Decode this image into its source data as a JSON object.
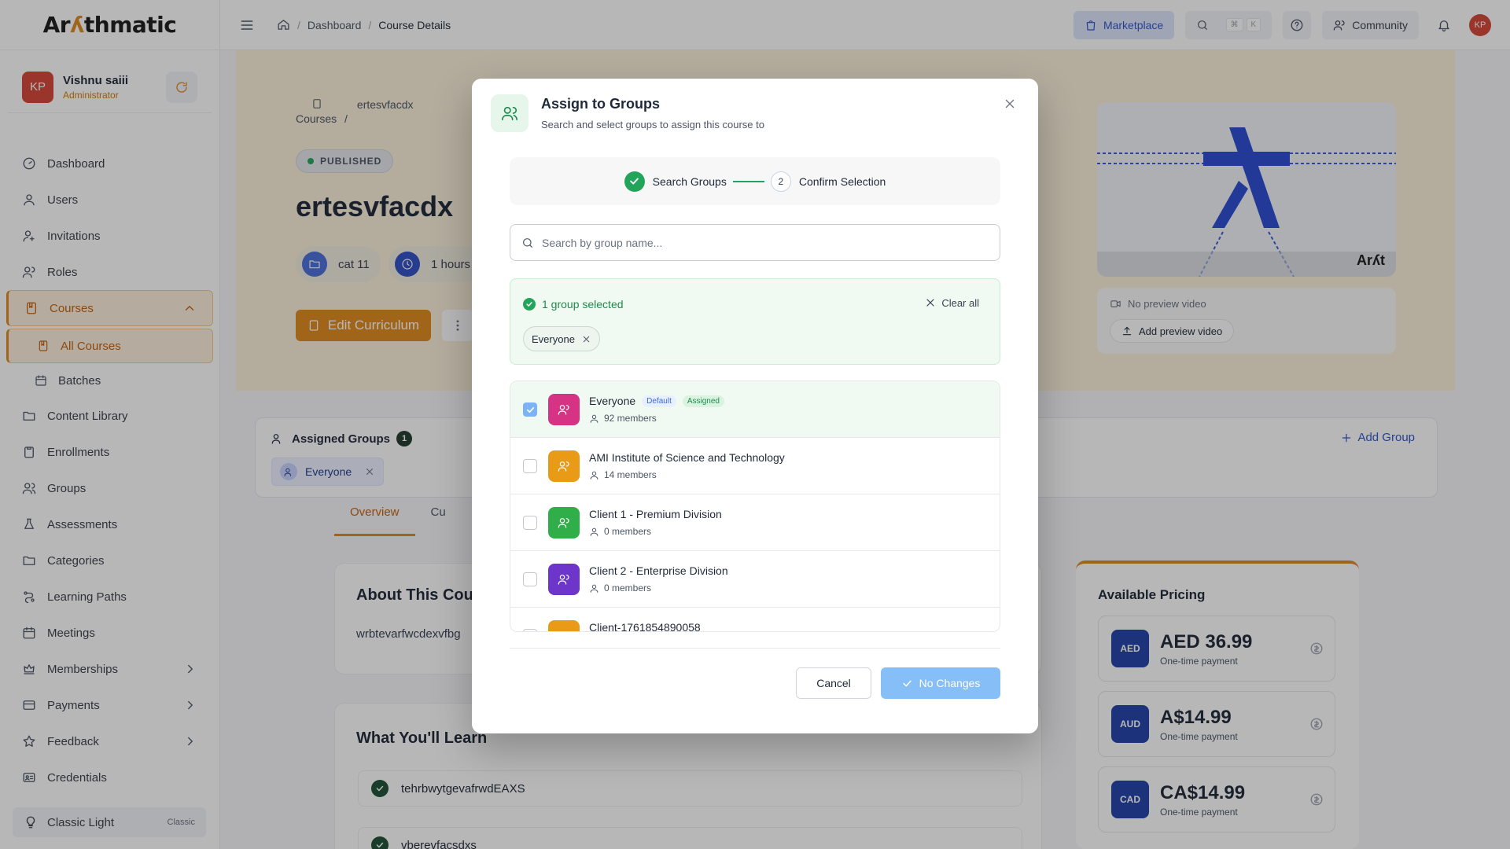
{
  "app": {
    "logo_text": "Arithmatic",
    "logo_a": "Ar",
    "logo_accent": "ʎ",
    "logo_b": "thmatic"
  },
  "user": {
    "initials": "KP",
    "name": "Vishnu saiii",
    "role": "Administrator"
  },
  "sidebar": {
    "items": [
      {
        "label": "Dashboard",
        "icon": "dashboard-icon"
      },
      {
        "label": "Users",
        "icon": "user-icon"
      },
      {
        "label": "Invitations",
        "icon": "invitation-icon"
      },
      {
        "label": "Roles",
        "icon": "roles-icon"
      },
      {
        "label": "Courses",
        "icon": "book-icon",
        "active": true
      },
      {
        "label": "All Courses",
        "icon": "book-icon",
        "sub": true,
        "active": true
      },
      {
        "label": "Batches",
        "icon": "calendar-icon",
        "sub": true
      },
      {
        "label": "Content Library",
        "icon": "folder-icon"
      },
      {
        "label": "Enrollments",
        "icon": "clipboard-icon"
      },
      {
        "label": "Groups",
        "icon": "groups-icon"
      },
      {
        "label": "Assessments",
        "icon": "flask-icon"
      },
      {
        "label": "Categories",
        "icon": "folder-icon"
      },
      {
        "label": "Learning Paths",
        "icon": "path-icon"
      },
      {
        "label": "Meetings",
        "icon": "calendar-icon"
      },
      {
        "label": "Memberships",
        "icon": "membership-icon"
      },
      {
        "label": "Payments",
        "icon": "card-icon"
      },
      {
        "label": "Feedback",
        "icon": "star-icon"
      },
      {
        "label": "Credentials",
        "icon": "id-card-icon"
      }
    ],
    "theme": {
      "label": "Classic Light",
      "tag": "Classic"
    }
  },
  "topbar": {
    "breadcrumb": [
      "Dashboard",
      "Course Details"
    ],
    "marketplace": "Marketplace",
    "kbd": [
      "⌘",
      "K"
    ],
    "community": "Community",
    "avatar": "KP"
  },
  "course": {
    "crumb_parent": "Courses",
    "crumb_sep": "/",
    "crumb_current": "ertesvfacdx",
    "status": "PUBLISHED",
    "title": "ertesvfacdx",
    "category": "cat 11",
    "duration": "1 hours",
    "edit_button": "Edit Curriculum",
    "preview": {
      "no_video": "No preview video",
      "add_video": "Add preview video",
      "brand": "Arʎt"
    }
  },
  "assigned": {
    "title": "Assigned Groups",
    "count": "1",
    "chip": "Everyone",
    "add_group": "Add Group"
  },
  "tabs": [
    "Overview",
    "Cu"
  ],
  "about": {
    "title": "About This Cour",
    "text": "wrbtevarfwcdexvfbg"
  },
  "learn": {
    "title": "What You'll Learn",
    "items": [
      "tehrbwytgevafrwdEAXS",
      "vberevfacsdxs"
    ]
  },
  "pricing": {
    "title": "Available Pricing",
    "items": [
      {
        "code": "AED",
        "amount": "AED 36.99",
        "type": "One-time payment"
      },
      {
        "code": "AUD",
        "amount": "A$14.99",
        "type": "One-time payment"
      },
      {
        "code": "CAD",
        "amount": "CA$14.99",
        "type": "One-time payment"
      }
    ]
  },
  "modal": {
    "title": "Assign to Groups",
    "subtitle": "Search and select groups to assign this course to",
    "steps": {
      "one": "Search Groups",
      "two_num": "2",
      "two": "Confirm Selection"
    },
    "search_placeholder": "Search by group name...",
    "selected_count": "1 group selected",
    "clear_all": "Clear all",
    "selected_chip": "Everyone",
    "groups": [
      {
        "name": "Everyone",
        "members": "92 members",
        "color": "#d63384",
        "checked": true,
        "tag_default": "Default",
        "tag_assigned": "Assigned"
      },
      {
        "name": "AMI Institute of Science and Technology",
        "members": "14 members",
        "color": "#e99a17",
        "checked": false
      },
      {
        "name": "Client 1 - Premium Division",
        "members": "0 members",
        "color": "#2fae4a",
        "checked": false
      },
      {
        "name": "Client 2 - Enterprise Division",
        "members": "0 members",
        "color": "#6d35c9",
        "checked": false
      },
      {
        "name": "Client-1761854890058",
        "members": "",
        "color": "#e99a17",
        "checked": false
      }
    ],
    "cancel": "Cancel",
    "confirm": "No Changes"
  }
}
